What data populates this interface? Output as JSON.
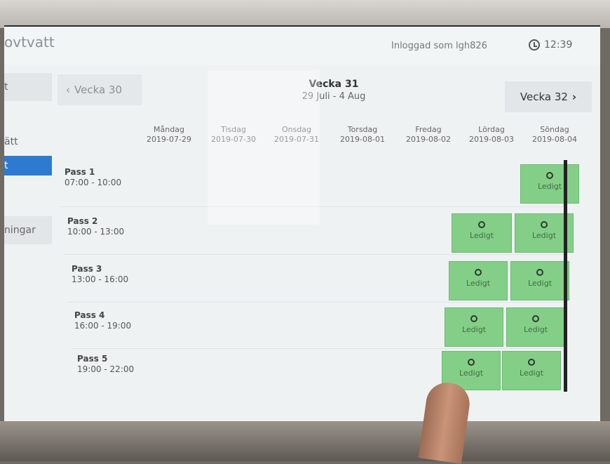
{
  "app": {
    "brand_fragment": "ovtvatt",
    "login_text": "Inloggad som lgh826",
    "time": "12:39"
  },
  "sidebar": {
    "items": [
      {
        "label": "t",
        "active": false
      },
      {
        "label": "ätt",
        "active": false
      },
      {
        "label": "t",
        "active": true
      },
      {
        "label": "ningar",
        "active": false
      }
    ]
  },
  "week_nav": {
    "prev_label": "Vecka 30",
    "next_label": "Vecka 32",
    "current_title": "Vecka 31",
    "current_range": "29 Juli - 4 Aug"
  },
  "days": [
    {
      "name": "Måndag",
      "date": "2019-07-29"
    },
    {
      "name": "Tisdag",
      "date": "2019-07-30"
    },
    {
      "name": "Onsdag",
      "date": "2019-07-31"
    },
    {
      "name": "Torsdag",
      "date": "2019-08-01"
    },
    {
      "name": "Fredag",
      "date": "2019-08-02"
    },
    {
      "name": "Lördag",
      "date": "2019-08-03"
    },
    {
      "name": "Söndag",
      "date": "2019-08-04"
    }
  ],
  "passes": [
    {
      "name": "Pass 1",
      "time": "07:00 - 10:00"
    },
    {
      "name": "Pass 2",
      "time": "10:00 - 13:00"
    },
    {
      "name": "Pass 3",
      "time": "13:00 - 16:00"
    },
    {
      "name": "Pass 4",
      "time": "16:00 - 19:00"
    },
    {
      "name": "Pass 5",
      "time": "19:00 - 22:00"
    }
  ],
  "slot_label": "Ledigt",
  "colors": {
    "available": "#84cf88",
    "active_nav": "#2d7bd1"
  }
}
